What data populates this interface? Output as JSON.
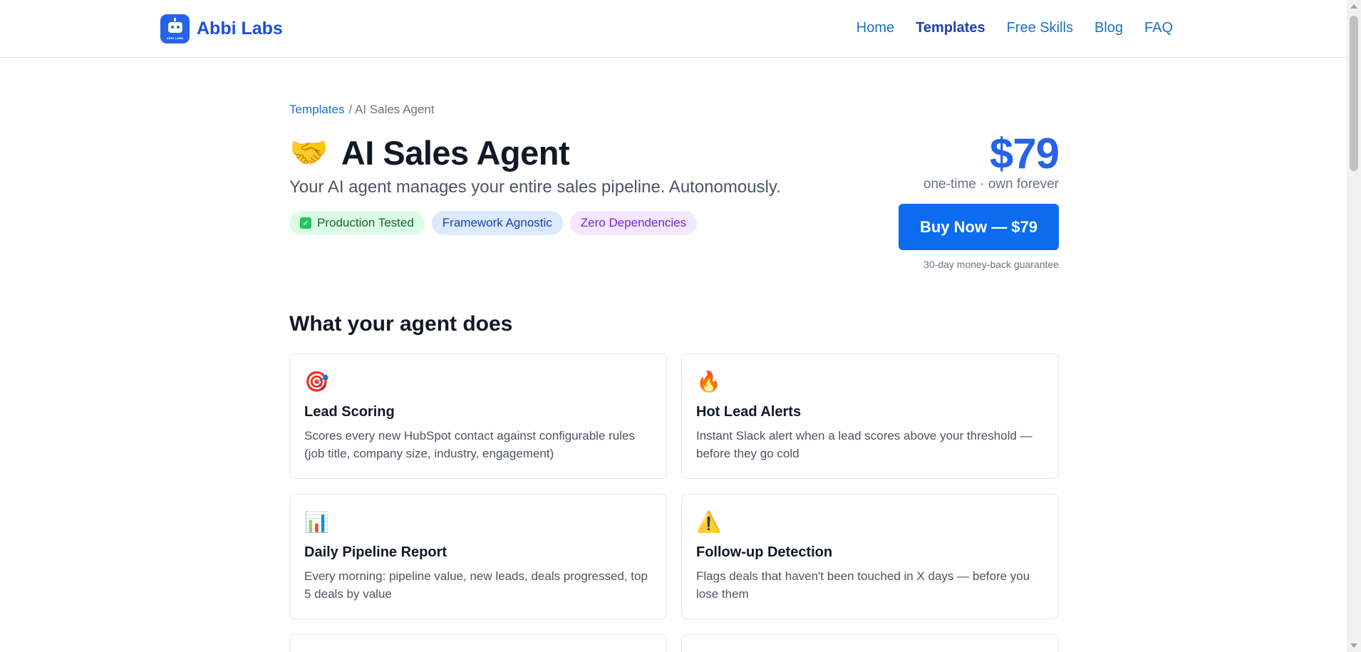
{
  "brand": {
    "name": "Abbi Labs",
    "logo_caption": "ABBI LABS",
    "logo_icon": "robot-icon"
  },
  "nav": [
    {
      "label": "Home",
      "active": false
    },
    {
      "label": "Templates",
      "active": true
    },
    {
      "label": "Free Skills",
      "active": false
    },
    {
      "label": "Blog",
      "active": false
    },
    {
      "label": "FAQ",
      "active": false
    }
  ],
  "breadcrumb": {
    "link": "Templates",
    "current": "/ AI Sales Agent"
  },
  "product": {
    "emoji": "🤝",
    "title": "AI Sales Agent",
    "subtitle": "Your AI agent manages your entire sales pipeline. Autonomously.",
    "badges": [
      {
        "label": "Production Tested",
        "style": "green",
        "check": "✓"
      },
      {
        "label": "Framework Agnostic",
        "style": "blue"
      },
      {
        "label": "Zero Dependencies",
        "style": "purple"
      }
    ]
  },
  "pricing": {
    "price": "$79",
    "note": "one-time · own forever",
    "buy_label": "Buy Now — $79",
    "guarantee": "30-day money-back guarantee"
  },
  "features": {
    "title": "What your agent does",
    "items": [
      {
        "icon": "🎯",
        "title": "Lead Scoring",
        "desc": "Scores every new HubSpot contact against configurable rules (job title, company size, industry, engagement)"
      },
      {
        "icon": "🔥",
        "title": "Hot Lead Alerts",
        "desc": "Instant Slack alert when a lead scores above your threshold — before they go cold"
      },
      {
        "icon": "📊",
        "title": "Daily Pipeline Report",
        "desc": "Every morning: pipeline value, new leads, deals progressed, top 5 deals by value"
      },
      {
        "icon": "⚠️",
        "title": "Follow-up Detection",
        "desc": "Flags deals that haven't been touched in X days — before you lose them"
      }
    ]
  },
  "colors": {
    "accent": "#2563eb",
    "button": "#0b6cf0",
    "link": "#1e6fc9"
  }
}
